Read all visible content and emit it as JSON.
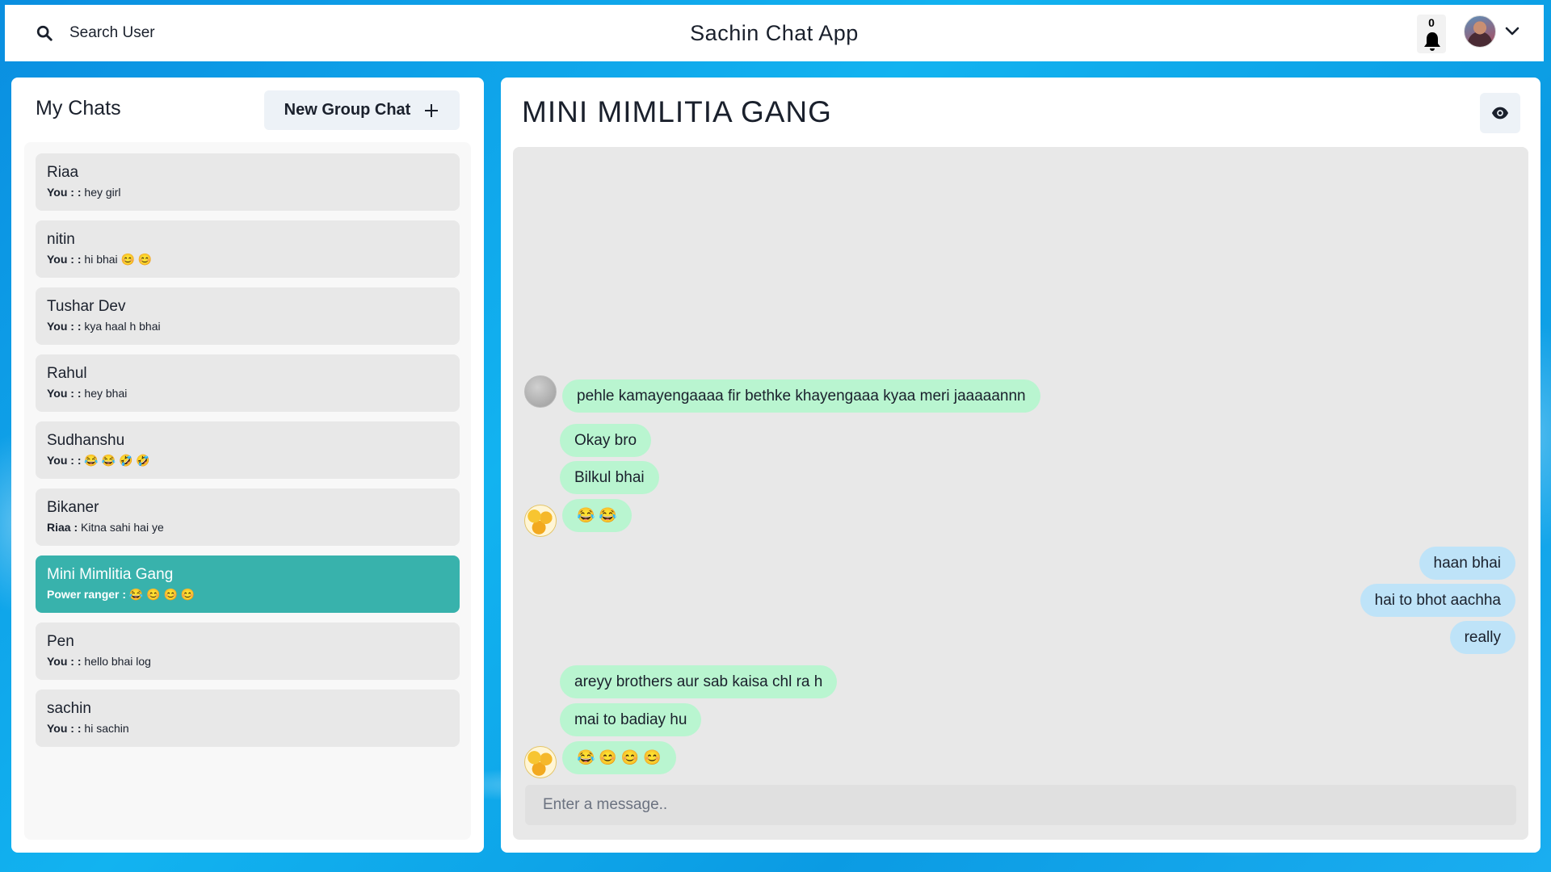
{
  "header": {
    "search_label": "Search User",
    "app_title": "Sachin Chat App",
    "notification_count": "0"
  },
  "sidebar": {
    "title": "My Chats",
    "new_group_label": "New Group Chat",
    "chats": [
      {
        "name": "Riaa",
        "sender": "You : :",
        "preview": "hey girl"
      },
      {
        "name": "nitin",
        "sender": "You : :",
        "preview": "hi bhai 😊 😊"
      },
      {
        "name": "Tushar Dev",
        "sender": "You : :",
        "preview": "kya haal h bhai"
      },
      {
        "name": "Rahul",
        "sender": "You : :",
        "preview": "hey bhai"
      },
      {
        "name": "Sudhanshu",
        "sender": "You : :",
        "preview": "😂 😂 🤣 🤣"
      },
      {
        "name": "Bikaner",
        "sender": "Riaa :",
        "preview": "Kitna sahi hai ye"
      },
      {
        "name": "Mini Mimlitia Gang",
        "sender": "Power ranger :",
        "preview": "😂 😊 😊 😊",
        "active": true
      },
      {
        "name": "Pen",
        "sender": "You : :",
        "preview": "hello bhai log"
      },
      {
        "name": "sachin",
        "sender": "You : :",
        "preview": "hi sachin"
      }
    ]
  },
  "chat": {
    "title": "MINI MIMLITIA GANG",
    "messages": [
      {
        "from": "them",
        "text": "pehle kamayengaaaa fir bethke khayengaaa kyaa meri jaaaaannn"
      },
      {
        "from": "them",
        "text": "Okay bro"
      },
      {
        "from": "them",
        "text": "Bilkul bhai"
      },
      {
        "from": "them",
        "text": "😂 😂"
      },
      {
        "from": "me",
        "text": "haan bhai"
      },
      {
        "from": "me",
        "text": "hai to bhot aachha"
      },
      {
        "from": "me",
        "text": "really"
      },
      {
        "from": "them",
        "text": "areyy brothers aur sab kaisa chl ra h"
      },
      {
        "from": "them",
        "text": "mai to badiay hu"
      },
      {
        "from": "them",
        "text": "😂 😊 😊 😊"
      }
    ],
    "input_placeholder": "Enter a message..",
    "input_value": ""
  },
  "colors": {
    "active_chat": "#38b2ac",
    "incoming_bubble": "#b9f5d0",
    "outgoing_bubble": "#bee3f8"
  }
}
